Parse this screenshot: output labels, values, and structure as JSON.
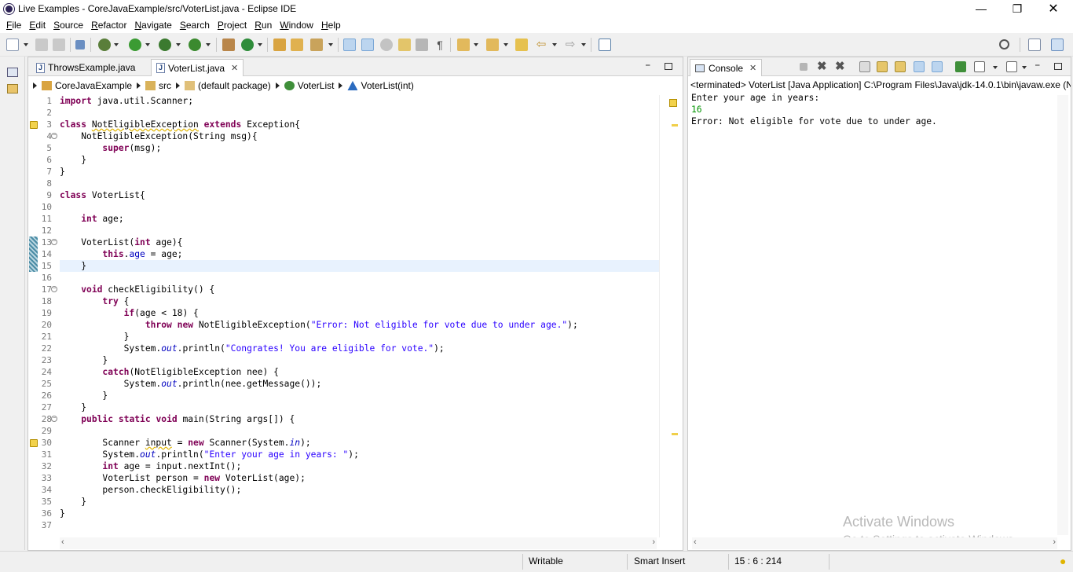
{
  "window": {
    "title": "Live Examples - CoreJavaExample/src/VoterList.java - Eclipse IDE"
  },
  "menu": [
    "File",
    "Edit",
    "Source",
    "Refactor",
    "Navigate",
    "Search",
    "Project",
    "Run",
    "Window",
    "Help"
  ],
  "editor": {
    "tabs": [
      {
        "label": "ThrowsExample.java",
        "active": false
      },
      {
        "label": "VoterList.java",
        "active": true
      }
    ],
    "breadcrumb": [
      "CoreJavaExample",
      "src",
      "(default package)",
      "VoterList",
      "VoterList(int)"
    ],
    "line_numbers": [
      "1",
      "2",
      "3",
      "4",
      "5",
      "6",
      "7",
      "8",
      "9",
      "10",
      "11",
      "12",
      "13",
      "14",
      "15",
      "16",
      "17",
      "18",
      "19",
      "20",
      "21",
      "22",
      "23",
      "24",
      "25",
      "26",
      "27",
      "28",
      "29",
      "30",
      "31",
      "32",
      "33",
      "34",
      "35",
      "36",
      "37"
    ],
    "code": [
      "import java.util.Scanner;",
      "",
      "class NotEligibleException extends Exception{",
      "    NotEligibleException(String msg){",
      "        super(msg);",
      "    }",
      "}",
      "",
      "class VoterList{",
      "",
      "    int age;",
      "",
      "    VoterList(int age){",
      "        this.age = age;",
      "    }",
      "",
      "    void checkEligibility() {",
      "        try {",
      "            if(age < 18) {",
      "                throw new NotEligibleException(\"Error: Not eligible for vote due to under age.\");",
      "            }",
      "            System.out.println(\"Congrates! You are eligible for vote.\");",
      "        }",
      "        catch(NotEligibleException nee) {",
      "            System.out.println(nee.getMessage());",
      "        }",
      "    }",
      "    public static void main(String args[]) {",
      "",
      "        Scanner input = new Scanner(System.in);",
      "        System.out.println(\"Enter your age in years: \");",
      "        int age = input.nextInt();",
      "        VoterList person = new VoterList(age);",
      "        person.checkEligibility();",
      "    }",
      "}",
      ""
    ]
  },
  "console": {
    "tab_label": "Console",
    "header": "<terminated> VoterList [Java Application] C:\\Program Files\\Java\\jdk-14.0.1\\bin\\javaw.exe  (N",
    "output": [
      "Enter your age in years:",
      "16",
      "Error: Not eligible for vote due to under age."
    ],
    "colors": {
      "stdout": "#000000",
      "stdin": "#009400"
    }
  },
  "watermark": {
    "title": "Activate Windows",
    "subtitle": "Go to Settings to activate Windows."
  },
  "status": {
    "writable": "Writable",
    "insert_mode": "Smart Insert",
    "position": "15 : 6 : 214"
  },
  "icons": [
    "new-icon",
    "save-icon",
    "save-all-icon",
    "debug-icon",
    "run-icon",
    "coverage-icon",
    "external-tools-icon",
    "new-java-project-icon",
    "open-type-icon",
    "search-icon",
    "perspective-icon",
    "java-perspective-icon",
    "console-icon",
    "lightbulb-icon"
  ],
  "colors": {
    "keyword": "#7f0055",
    "string": "#2a00ff",
    "field": "#0000c0",
    "highlight_line": "#e8f2fe",
    "line_number": "#787878"
  }
}
